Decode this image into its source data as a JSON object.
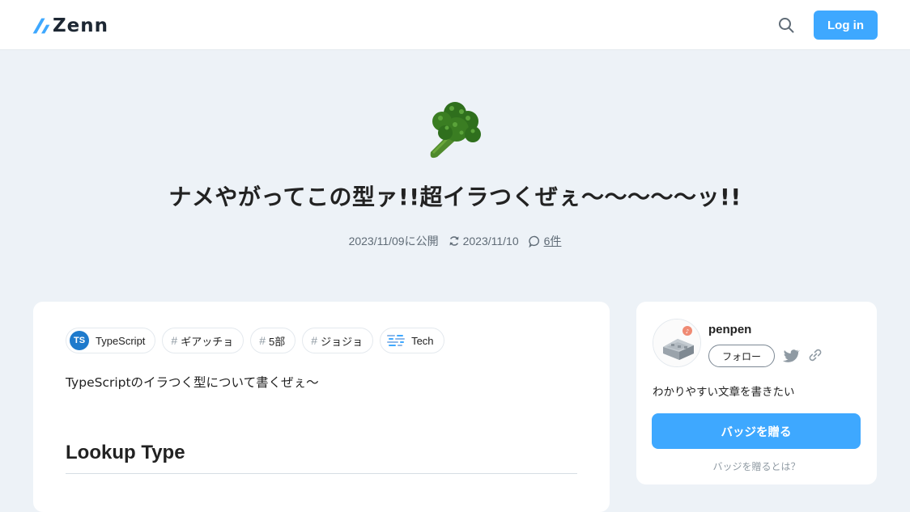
{
  "header": {
    "logo_text": "Zenn",
    "login_label": "Log in"
  },
  "article": {
    "emoji": "broccoli-emoji",
    "title": "ナメやがってこの型ァ!!超イラつくぜぇ〜〜〜〜〜ッ!!",
    "published": "2023/11/09に公開",
    "updated": "2023/11/10",
    "comments": "6件",
    "topics": [
      {
        "label": "TypeScript",
        "icon": "typescript-icon",
        "icon_text": "TS"
      },
      {
        "label": "ギアッチョ",
        "icon": "hash-icon"
      },
      {
        "label": "5部",
        "icon": "hash-icon"
      },
      {
        "label": "ジョジョ",
        "icon": "hash-icon"
      },
      {
        "label": "Tech",
        "icon": "tech-icon"
      }
    ],
    "intro": "TypeScriptのイラつく型について書くぜぇ〜",
    "heading": "Lookup Type"
  },
  "author": {
    "name": "penpen",
    "follow_label": "フォロー",
    "bio": "わかりやすい文章を書きたい",
    "badge_label": "バッジを贈る",
    "badge_help": "バッジを贈るとは？"
  },
  "colors": {
    "accent": "#3ea8ff",
    "page_bg": "#edf2f7",
    "typescript": "#1e7acc"
  }
}
